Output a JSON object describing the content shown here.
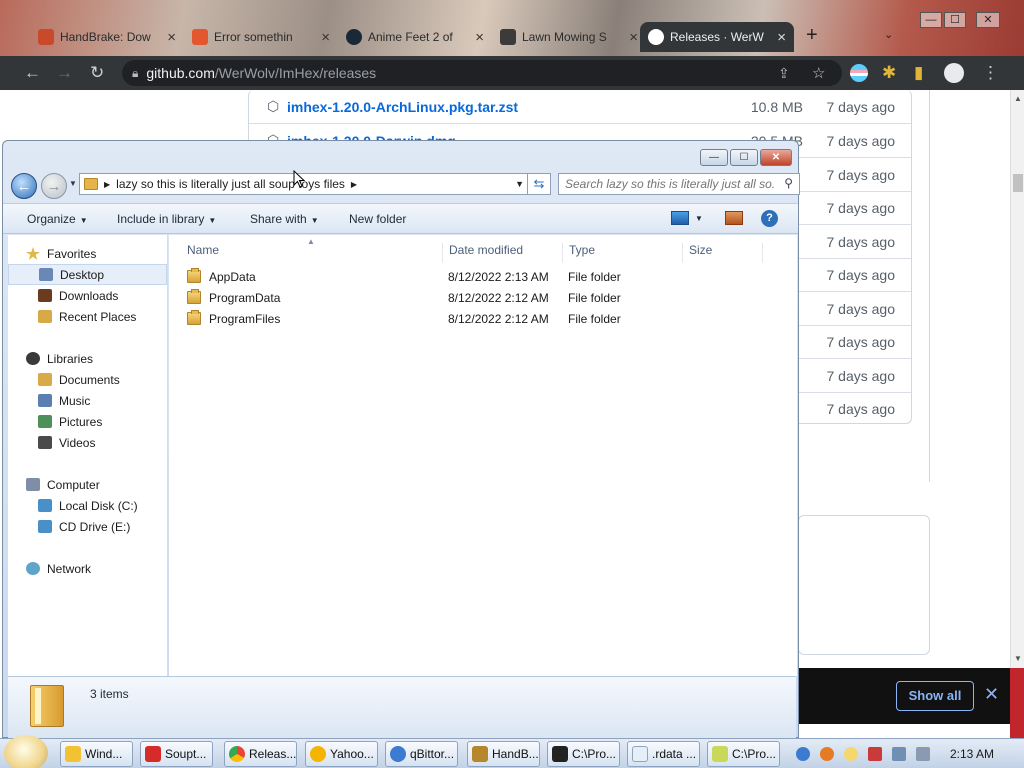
{
  "browser": {
    "tabs": [
      {
        "label": "HandBrake: Dow",
        "favicon_color": "#c94a2a",
        "active": false
      },
      {
        "label": "Error somethin",
        "favicon_color": "#e4572e",
        "active": false
      },
      {
        "label": "Anime Feet 2 of",
        "favicon_color": "#1b2838",
        "active": false
      },
      {
        "label": "Lawn Mowing S",
        "favicon_color": "#3b3b3b",
        "active": false
      },
      {
        "label": "Releases · WerW",
        "favicon_color": "#ffffff",
        "active": true
      }
    ],
    "new_tab_glyph": "+",
    "window_controls": {
      "minimize": "—",
      "maximize": "☐",
      "close": "✕"
    },
    "url_host": "github.com",
    "url_path": "/WerWolv/ImHex/releases",
    "assets": [
      {
        "name": "imhex-1.20.0-ArchLinux.pkg.tar.zst",
        "size": "10.8 MB",
        "date": "7 days ago"
      },
      {
        "name": "imhex-1.20.0-Darwin.dmg",
        "size": "20.5 MB",
        "date": "7 days ago"
      },
      {
        "name": "",
        "size": "",
        "date": "7 days ago"
      },
      {
        "name": "",
        "size": "",
        "date": "7 days ago"
      },
      {
        "name": "",
        "size": "",
        "date": "7 days ago"
      },
      {
        "name": "",
        "size": "",
        "date": "7 days ago"
      },
      {
        "name": "",
        "size": "",
        "date": "7 days ago"
      },
      {
        "name": "",
        "size": "",
        "date": "7 days ago"
      },
      {
        "name": "",
        "size": "",
        "date": "7 days ago"
      },
      {
        "name": "",
        "size": "",
        "date": "7 days ago"
      }
    ],
    "download_bar": {
      "show_all": "Show all",
      "close": "✕"
    }
  },
  "explorer": {
    "caption": {
      "minimize": "—",
      "maximize": "☐",
      "close": "✕"
    },
    "address_path": "lazy so this is literally just all soup toys files",
    "search_placeholder": "Search lazy so this is literally just all so...",
    "commands": {
      "organize": "Organize",
      "include_in_library": "Include in library",
      "share_with": "Share with",
      "new_folder": "New folder"
    },
    "nav": {
      "favorites": "Favorites",
      "desktop": "Desktop",
      "downloads": "Downloads",
      "recent_places": "Recent Places",
      "libraries": "Libraries",
      "documents": "Documents",
      "music": "Music",
      "pictures": "Pictures",
      "videos": "Videos",
      "computer": "Computer",
      "local_disk": "Local Disk (C:)",
      "cd_drive": "CD Drive (E:)",
      "network": "Network"
    },
    "columns": {
      "name": "Name",
      "date_modified": "Date modified",
      "type": "Type",
      "size": "Size"
    },
    "files": [
      {
        "name": "AppData",
        "date": "8/12/2022 2:13 AM",
        "type": "File folder"
      },
      {
        "name": "ProgramData",
        "date": "8/12/2022 2:12 AM",
        "type": "File folder"
      },
      {
        "name": "ProgramFiles",
        "date": "8/12/2022 2:12 AM",
        "type": "File folder"
      }
    ],
    "status": "3 items"
  },
  "taskbar": {
    "buttons": [
      {
        "label": "Wind...",
        "icon_color": "#f1c232"
      },
      {
        "label": "Soupt...",
        "icon_color": "#d62b2b"
      },
      {
        "label": "Releas...",
        "icon_color": "#4285f4"
      },
      {
        "label": "Yahoo...",
        "icon_color": "#f5b400"
      },
      {
        "label": "qBittor...",
        "icon_color": "#3d7bd1"
      },
      {
        "label": "HandB...",
        "icon_color": "#b5862b"
      },
      {
        "label": "C:\\Pro...",
        "icon_color": "#222222"
      },
      {
        "label": ".rdata ...",
        "icon_color": "#e6eef7"
      },
      {
        "label": "C:\\Pro...",
        "icon_color": "#c9d85a"
      }
    ],
    "clock": "2:13 AM"
  }
}
